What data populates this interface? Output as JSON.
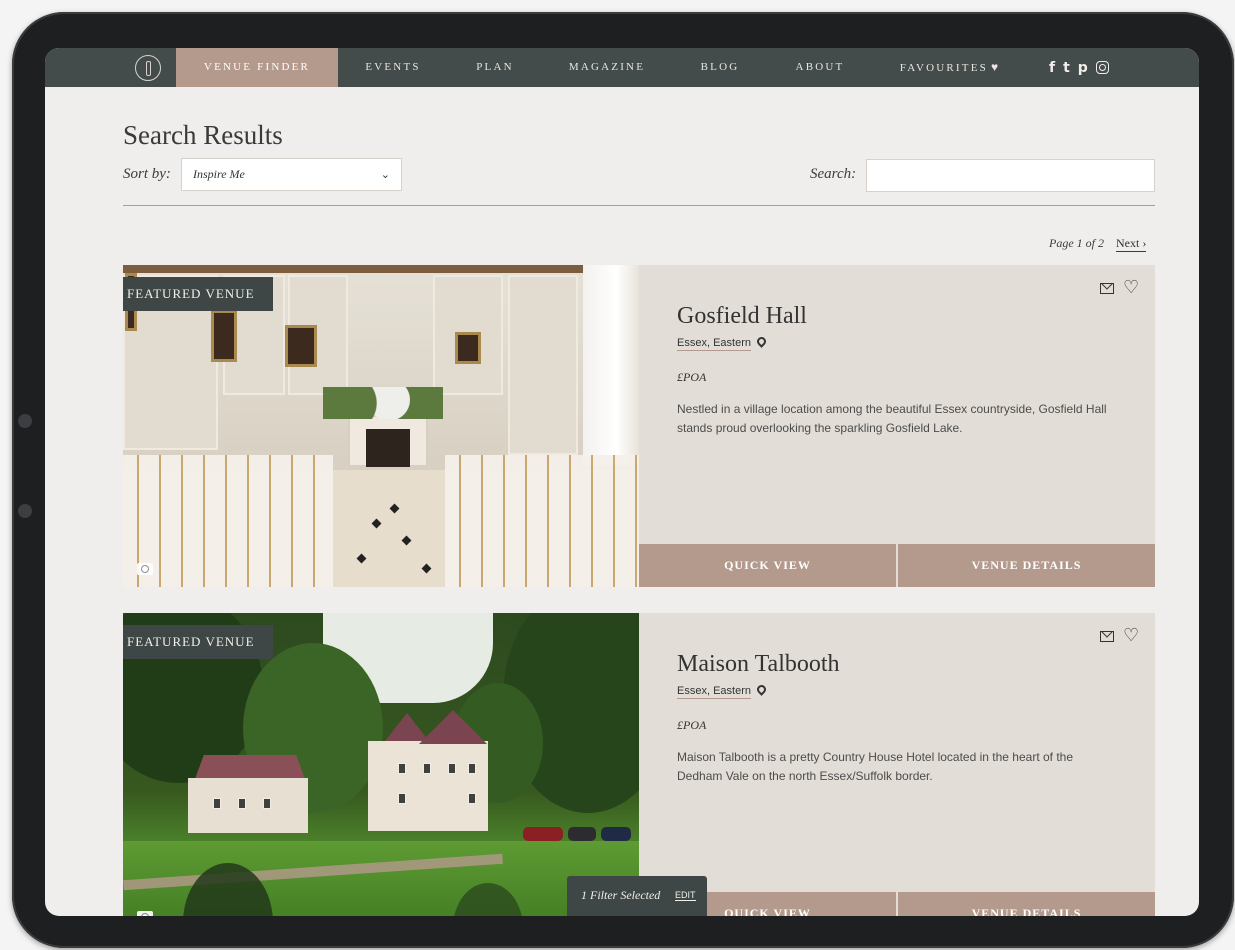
{
  "nav": {
    "items": [
      "Venue Finder",
      "Events",
      "Plan",
      "Magazine",
      "Blog",
      "About",
      "Favourites"
    ],
    "active": "Venue Finder",
    "social": [
      "f",
      "t",
      "p"
    ]
  },
  "header": {
    "title": "Search Results",
    "sort_label": "Sort by:",
    "sort_value": "Inspire Me",
    "search_label": "Search:",
    "search_value": ""
  },
  "pager": {
    "page_text": "Page 1 of 2",
    "next_label": "Next ›"
  },
  "icons": {
    "sort_chevron": "chevron-down-icon",
    "search": "search-icon",
    "mail": "mail-icon",
    "heart": "heart-icon",
    "pin": "location-pin-icon",
    "camera": "camera-icon"
  },
  "colors": {
    "nav_bg": "#434c4a",
    "accent": "#b39a8c",
    "card_bg": "#e2ded7",
    "badge_bg": "#3e4745"
  },
  "venues": [
    {
      "badge": "Featured Venue",
      "name": "Gosfield Hall",
      "location": "Essex, Eastern",
      "price": "£POA",
      "description": "Nestled in a village location among the beautiful Essex countryside, Gosfield Hall stands proud overlooking the sparkling Gosfield Lake.",
      "quick_view": "Quick View",
      "details": "Venue Details"
    },
    {
      "badge": "Featured Venue",
      "name": "Maison Talbooth",
      "location": "Essex, Eastern",
      "price": "£POA",
      "description": "Maison Talbooth is a pretty Country House Hotel located in the heart of the Dedham Vale on the north Essex/Suffolk border.",
      "quick_view": "Quick View",
      "details": "Venue Details"
    }
  ],
  "filter": {
    "label": "1 Filter Selected",
    "edit": "Edit"
  }
}
